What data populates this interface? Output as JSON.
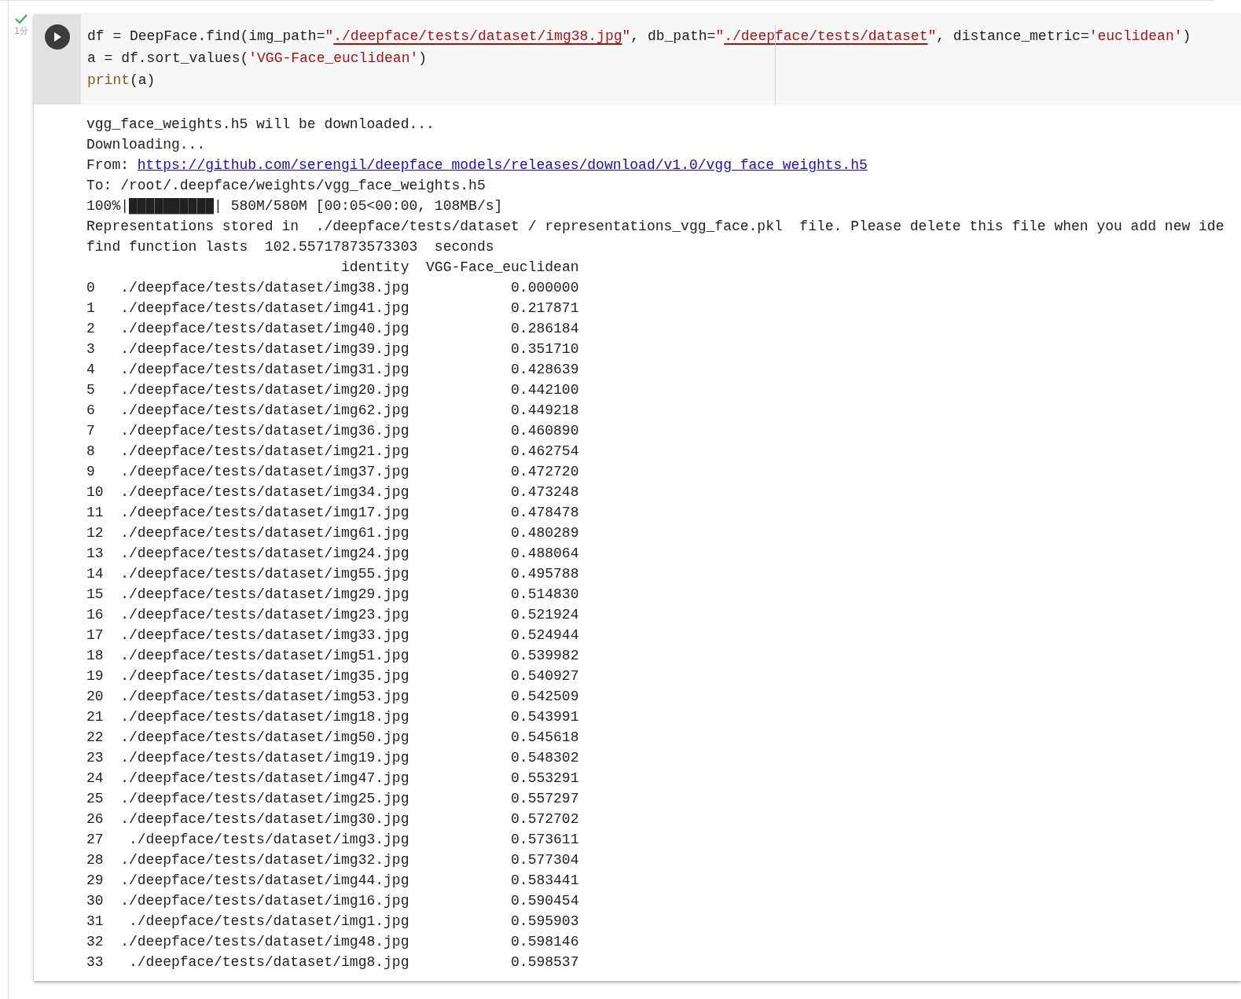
{
  "cell": {
    "succeeded": true,
    "time": "1分",
    "code_lines": [
      [
        {
          "kind": "plain",
          "text": "df = DeepFace.find(img_path="
        },
        {
          "kind": "string",
          "text": "\""
        },
        {
          "kind": "path",
          "text": "./deepface/tests/dataset/img38.jpg"
        },
        {
          "kind": "string",
          "text": "\""
        },
        {
          "kind": "plain",
          "text": ", db_path="
        },
        {
          "kind": "string",
          "text": "\""
        },
        {
          "kind": "path",
          "text": "./deepface/tests/dataset"
        },
        {
          "kind": "string",
          "text": "\""
        },
        {
          "kind": "plain",
          "text": ", distance_metric="
        },
        {
          "kind": "string",
          "text": "'euclidean'"
        },
        {
          "kind": "plain",
          "text": ")"
        }
      ],
      [
        {
          "kind": "plain",
          "text": "a = df.sort_values("
        },
        {
          "kind": "string",
          "text": "'VGG-Face_euclidean'"
        },
        {
          "kind": "plain",
          "text": ")"
        }
      ],
      [
        {
          "kind": "builtin",
          "text": "print"
        },
        {
          "kind": "plain",
          "text": "(a)"
        }
      ]
    ],
    "output": [
      {
        "kind": "text",
        "text": "vgg_face_weights.h5 will be downloaded..."
      },
      {
        "kind": "text",
        "text": "Downloading..."
      },
      {
        "kind": "link",
        "prefix": "From: ",
        "text": "https://github.com/serengil/deepface_models/releases/download/v1.0/vgg_face_weights.h5"
      },
      {
        "kind": "text",
        "text": "To: /root/.deepface/weights/vgg_face_weights.h5"
      },
      {
        "kind": "text",
        "text": "100%|██████████| 580M/580M [00:05<00:00, 108MB/s]"
      },
      {
        "kind": "text",
        "text": "Representations stored in  ./deepface/tests/dataset / representations_vgg_face.pkl  file. Please delete this file when you add new ide"
      },
      {
        "kind": "text",
        "text": "find function lasts  102.55717873573303  seconds"
      }
    ],
    "table": {
      "columns": [
        "identity",
        "VGG-Face_euclidean"
      ],
      "rows": [
        {
          "index": "0",
          "identity": "./deepface/tests/dataset/img38.jpg",
          "value": "0.000000"
        },
        {
          "index": "1",
          "identity": "./deepface/tests/dataset/img41.jpg",
          "value": "0.217871"
        },
        {
          "index": "2",
          "identity": "./deepface/tests/dataset/img40.jpg",
          "value": "0.286184"
        },
        {
          "index": "3",
          "identity": "./deepface/tests/dataset/img39.jpg",
          "value": "0.351710"
        },
        {
          "index": "4",
          "identity": "./deepface/tests/dataset/img31.jpg",
          "value": "0.428639"
        },
        {
          "index": "5",
          "identity": "./deepface/tests/dataset/img20.jpg",
          "value": "0.442100"
        },
        {
          "index": "6",
          "identity": "./deepface/tests/dataset/img62.jpg",
          "value": "0.449218"
        },
        {
          "index": "7",
          "identity": "./deepface/tests/dataset/img36.jpg",
          "value": "0.460890"
        },
        {
          "index": "8",
          "identity": "./deepface/tests/dataset/img21.jpg",
          "value": "0.462754"
        },
        {
          "index": "9",
          "identity": "./deepface/tests/dataset/img37.jpg",
          "value": "0.472720"
        },
        {
          "index": "10",
          "identity": "./deepface/tests/dataset/img34.jpg",
          "value": "0.473248"
        },
        {
          "index": "11",
          "identity": "./deepface/tests/dataset/img17.jpg",
          "value": "0.478478"
        },
        {
          "index": "12",
          "identity": "./deepface/tests/dataset/img61.jpg",
          "value": "0.480289"
        },
        {
          "index": "13",
          "identity": "./deepface/tests/dataset/img24.jpg",
          "value": "0.488064"
        },
        {
          "index": "14",
          "identity": "./deepface/tests/dataset/img55.jpg",
          "value": "0.495788"
        },
        {
          "index": "15",
          "identity": "./deepface/tests/dataset/img29.jpg",
          "value": "0.514830"
        },
        {
          "index": "16",
          "identity": "./deepface/tests/dataset/img23.jpg",
          "value": "0.521924"
        },
        {
          "index": "17",
          "identity": "./deepface/tests/dataset/img33.jpg",
          "value": "0.524944"
        },
        {
          "index": "18",
          "identity": "./deepface/tests/dataset/img51.jpg",
          "value": "0.539982"
        },
        {
          "index": "19",
          "identity": "./deepface/tests/dataset/img35.jpg",
          "value": "0.540927"
        },
        {
          "index": "20",
          "identity": "./deepface/tests/dataset/img53.jpg",
          "value": "0.542509"
        },
        {
          "index": "21",
          "identity": "./deepface/tests/dataset/img18.jpg",
          "value": "0.543991"
        },
        {
          "index": "22",
          "identity": "./deepface/tests/dataset/img50.jpg",
          "value": "0.545618"
        },
        {
          "index": "23",
          "identity": "./deepface/tests/dataset/img19.jpg",
          "value": "0.548302"
        },
        {
          "index": "24",
          "identity": "./deepface/tests/dataset/img47.jpg",
          "value": "0.553291"
        },
        {
          "index": "25",
          "identity": "./deepface/tests/dataset/img25.jpg",
          "value": "0.557297"
        },
        {
          "index": "26",
          "identity": "./deepface/tests/dataset/img30.jpg",
          "value": "0.572702"
        },
        {
          "index": "27",
          "identity": "./deepface/tests/dataset/img3.jpg",
          "value": "0.573611"
        },
        {
          "index": "28",
          "identity": "./deepface/tests/dataset/img32.jpg",
          "value": "0.577304"
        },
        {
          "index": "29",
          "identity": "./deepface/tests/dataset/img44.jpg",
          "value": "0.583441"
        },
        {
          "index": "30",
          "identity": "./deepface/tests/dataset/img16.jpg",
          "value": "0.590454"
        },
        {
          "index": "31",
          "identity": "./deepface/tests/dataset/img1.jpg",
          "value": "0.595903"
        },
        {
          "index": "32",
          "identity": "./deepface/tests/dataset/img48.jpg",
          "value": "0.598146"
        },
        {
          "index": "33",
          "identity": "./deepface/tests/dataset/img8.jpg",
          "value": "0.598537"
        }
      ]
    }
  }
}
